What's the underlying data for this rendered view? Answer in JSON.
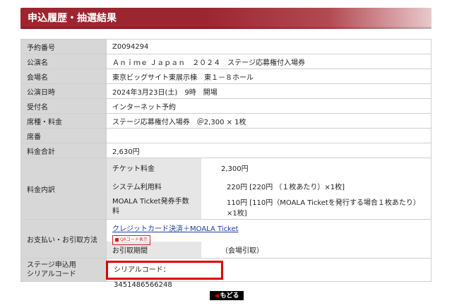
{
  "header": {
    "title": "申込履歴・抽選結果"
  },
  "rows": [
    {
      "label": "予約番号",
      "value": "Z0094294"
    },
    {
      "label": "公演名",
      "value": "Ａｎｉｍｅ Ｊａｐａｎ　２０２４　ステージ応募権付入場券"
    },
    {
      "label": "会場名",
      "value": "東京ビッグサイト東展示棟　東１－８ホール"
    },
    {
      "label": "公演日時",
      "value": "2024年3月23日(土)　9時　開場"
    },
    {
      "label": "受付名",
      "value": "インターネット予約"
    },
    {
      "label": "席種・料金",
      "value": "ステージ応募権付入場券　＠2,300 × 1枚"
    },
    {
      "label": "席番",
      "value": ""
    },
    {
      "label": "料金合計",
      "value": "2,630円"
    }
  ],
  "fee_breakdown": {
    "label": "料金内訳",
    "items": [
      {
        "name": "チケット料金",
        "value": "2,300円"
      },
      {
        "name": "システム利用料",
        "value": "220円 [220円 （１枚あたり）×1枚]"
      },
      {
        "name": "MOALA Ticket発券手数料",
        "value": "110円 [110円（MOALA Ticketを発行する場合１枚あたり）×1枚]"
      }
    ]
  },
  "payment": {
    "label": "お支払い・お引取方法",
    "method": "クレジットカード決済＋MOALA Ticket",
    "qr_badge": "QRコード表示",
    "pickup_label": "お引取期間",
    "pickup_value": "（会場引取）"
  },
  "serial": {
    "label_line1": "ステージ申込用",
    "label_line2": "シリアルコード",
    "value": "シリアルコード：3451486566248"
  },
  "back_button": {
    "label": "もどる"
  },
  "colors": {
    "header": "#9b2630",
    "highlight": "#e00000",
    "link": "#1f3aa5"
  }
}
